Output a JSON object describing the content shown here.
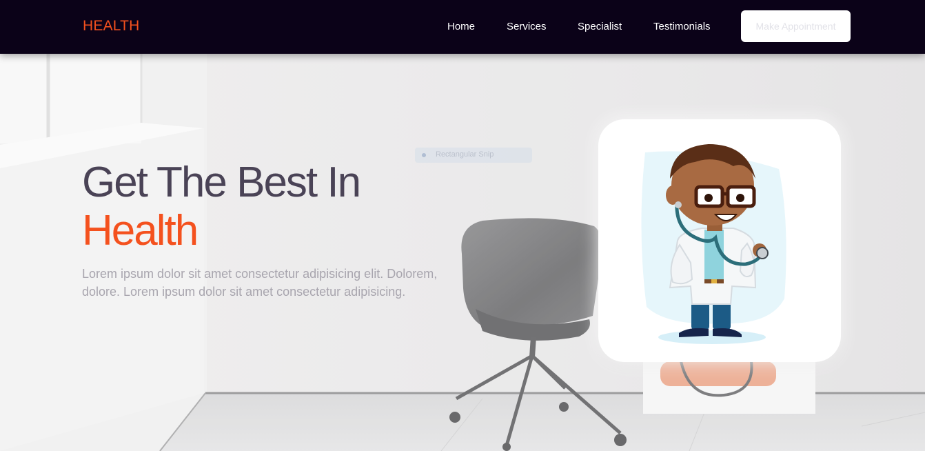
{
  "navbar": {
    "brand": "HEALTH",
    "links": [
      "Home",
      "Services",
      "Specialist",
      "Testimonials"
    ],
    "cta_label": "Make Appointment"
  },
  "hero": {
    "title_line1": "Get The Best In",
    "title_line2": "Health",
    "description": "Lorem ipsum dolor sit amet consectetur adipisicing elit. Dolorem, dolore. Lorem ipsum dolor sit amet consectetur adipisicing.",
    "toast_text": "Rectangular Snip"
  },
  "colors": {
    "navbar_bg": "#0b0218",
    "accent": "#f4511e",
    "title": "#4a4356",
    "body_text": "#a8a5ae"
  },
  "images": {
    "background": "room-with-chair",
    "card": "cartoon-doctor-with-stethoscope"
  }
}
